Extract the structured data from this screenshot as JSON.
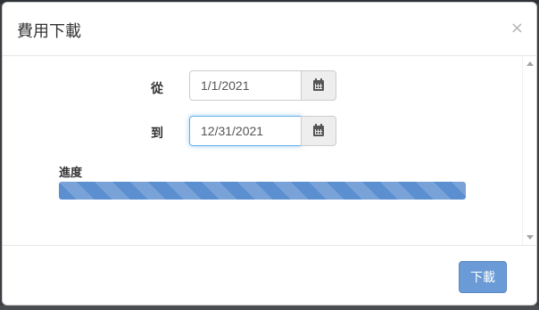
{
  "dialog": {
    "title": "費用下載",
    "close_glyph": "×"
  },
  "form": {
    "from_label": "從",
    "from_value": "1/1/2021",
    "to_label": "到",
    "to_value": "12/31/2021",
    "calendar_icon": "calendar-icon"
  },
  "progress": {
    "label": "進度",
    "percent": 100,
    "color": "#5b8fd0"
  },
  "footer": {
    "download_label": "下載",
    "button_color": "#6a9bd6"
  }
}
